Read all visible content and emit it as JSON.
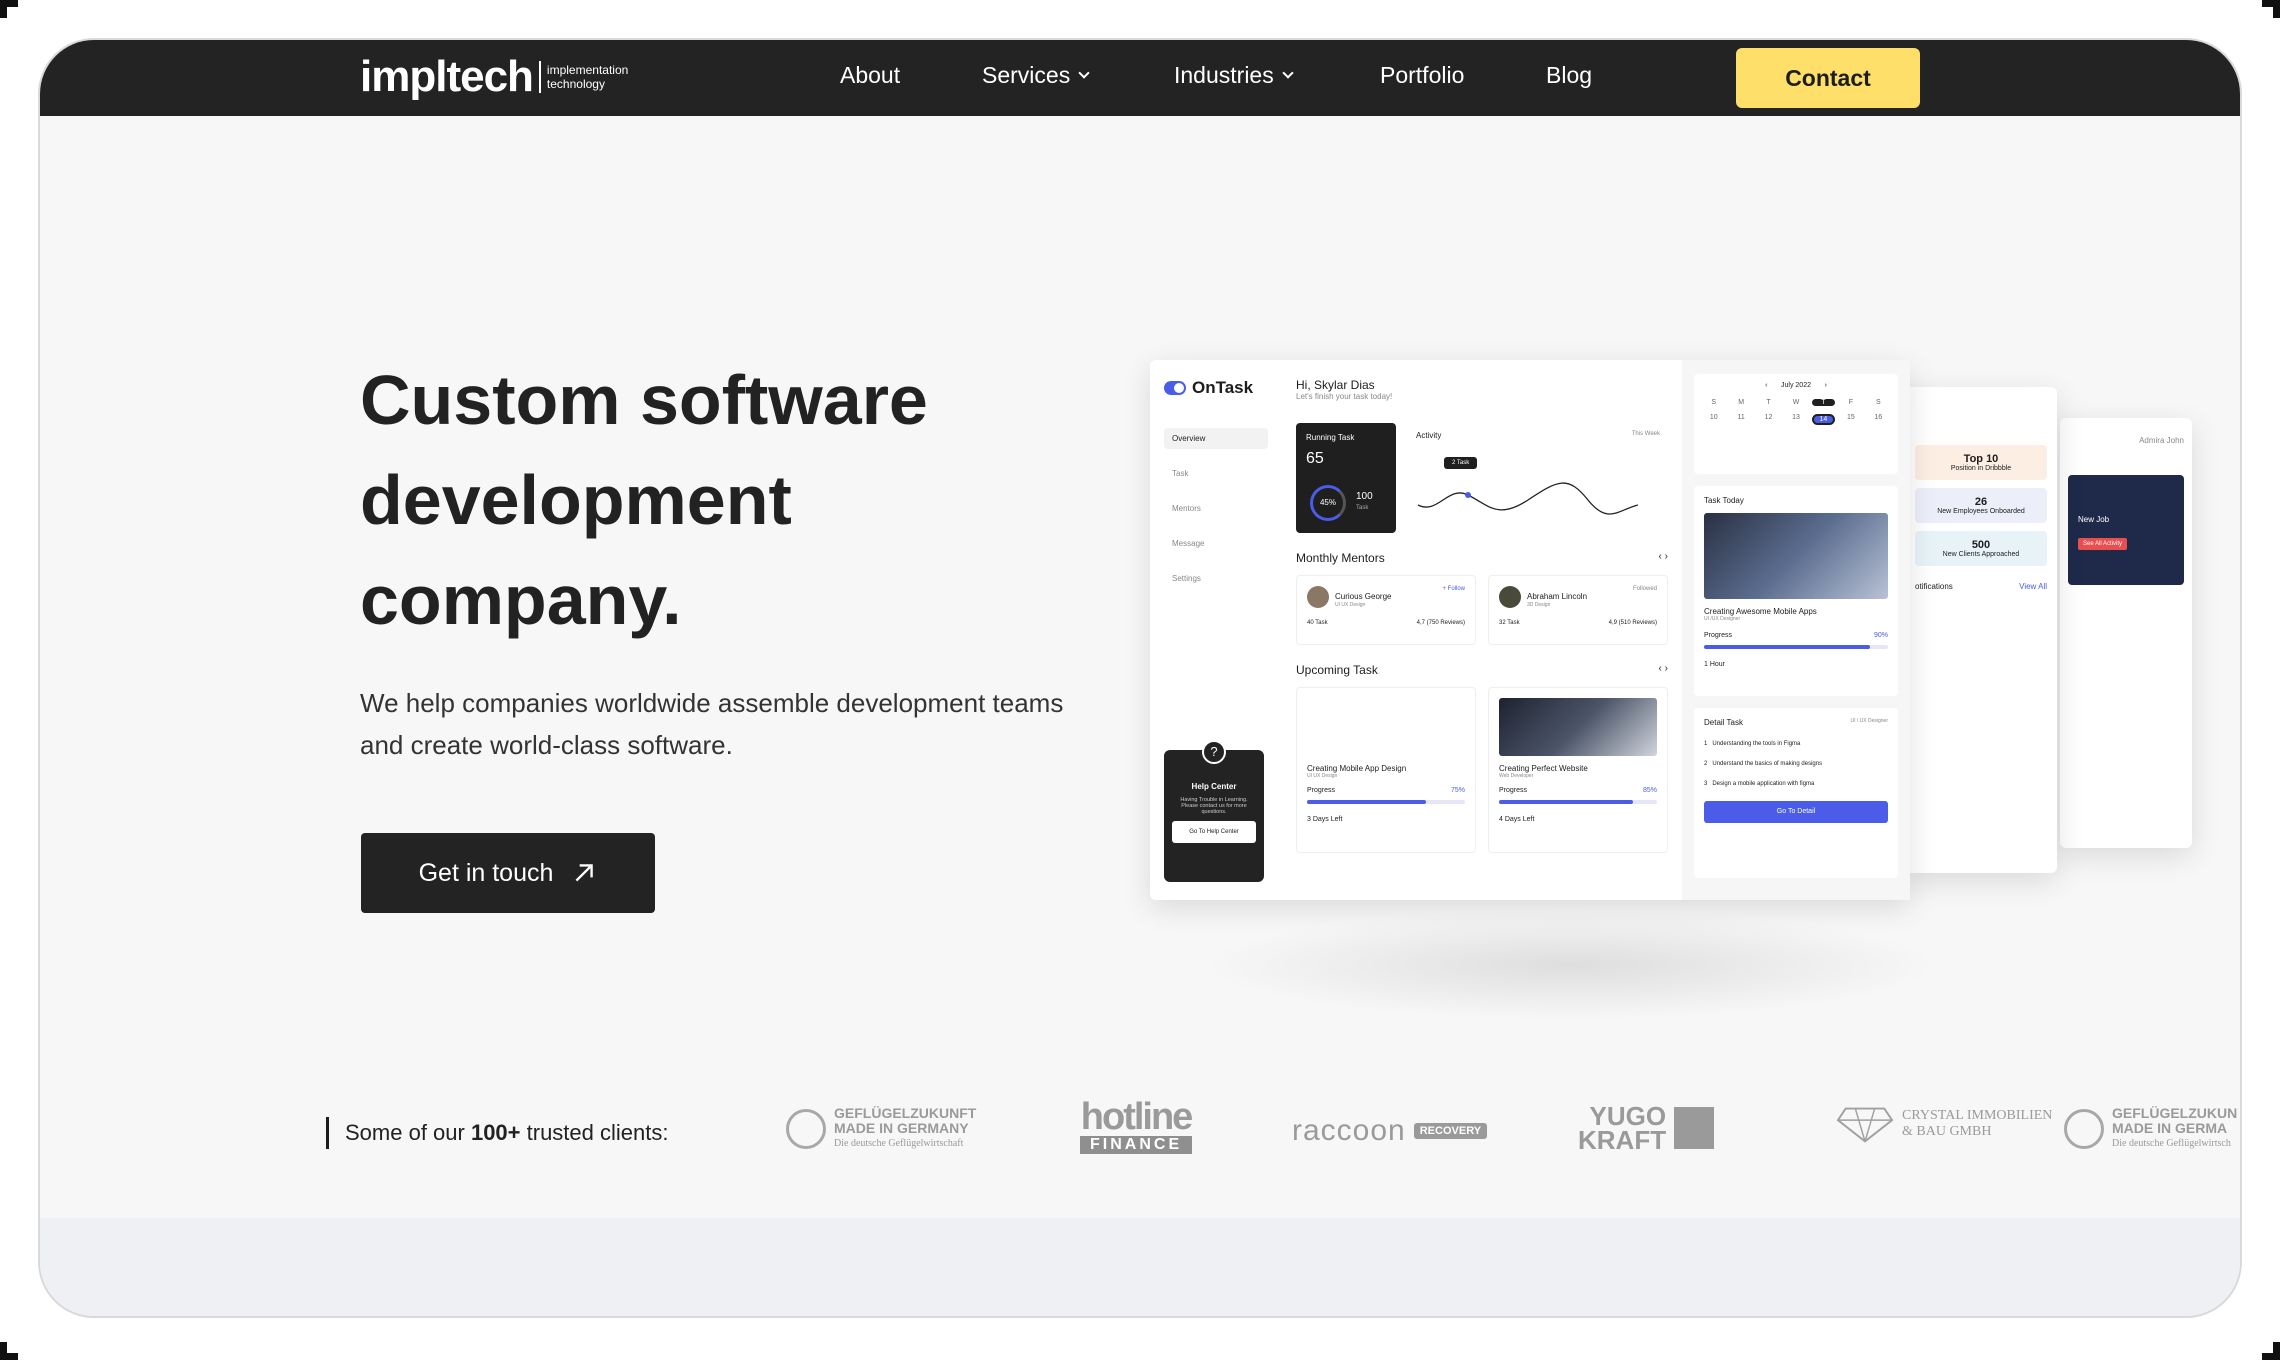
{
  "nav": {
    "logo_word": "impltech",
    "logo_tagline_1": "implementation",
    "logo_tagline_2": "technology",
    "links": [
      "About",
      "Services",
      "Industries",
      "Portfolio",
      "Blog"
    ],
    "contact": "Contact"
  },
  "hero": {
    "title_line1": "Custom software",
    "title_line2": "development",
    "title_line3": "company.",
    "subtitle": "We help companies worldwide assemble development teams and create world-class software.",
    "cta": "Get in touch"
  },
  "mockup": {
    "brand": "OnTask",
    "side_nav": [
      "Overview",
      "Task",
      "Mentors",
      "Message",
      "Settings"
    ],
    "help_title": "Help Center",
    "help_desc": "Having Trouble in Learning. Please contact us for more questions.",
    "help_button": "Go To Help Center",
    "greeting": "Hi, Skylar Dias",
    "greeting_sub": "Let's finish your task today!",
    "running_label": "Running Task",
    "running_value": "65",
    "running_pct": "45%",
    "running_total": "100",
    "running_total_label": "Task",
    "activity_label": "Activity",
    "activity_period": "This Week",
    "activity_badge": "2 Task",
    "monthly_mentors": "Monthly Mentors",
    "mentor1_name": "Curious George",
    "mentor1_role": "UI UX Design",
    "mentor1_action": "+ Follow",
    "mentor1_tasks": "40 Task",
    "mentor1_rating": "4,7 (750 Reviews)",
    "mentor2_name": "Abraham Lincoln",
    "mentor2_role": "3D Design",
    "mentor2_action": "Followed",
    "mentor2_tasks": "32 Task",
    "mentor2_rating": "4,9 (510 Reviews)",
    "upcoming": "Upcoming Task",
    "task1_title": "Creating Mobile App Design",
    "task1_role": "UI UX Design",
    "task1_progress_label": "Progress",
    "task1_progress": "75%",
    "task1_progress_value": 0.75,
    "task1_left": "3 Days Left",
    "task2_title": "Creating Perfect Website",
    "task2_role": "Web Developer",
    "task2_progress_label": "Progress",
    "task2_progress": "85%",
    "task2_progress_value": 0.85,
    "task2_left": "4 Days Left",
    "calendar_month": "July 2022",
    "calendar_days": [
      "S",
      "M",
      "T",
      "W",
      "T",
      "F",
      "S"
    ],
    "calendar_dates": [
      "10",
      "11",
      "12",
      "13",
      "14",
      "15",
      "16"
    ],
    "task_today": "Task Today",
    "today_title": "Creating Awesome Mobile Apps",
    "today_role": "UI /UX Designer",
    "today_progress_label": "Progress",
    "today_progress": "90%",
    "today_progress_value": 0.9,
    "today_time": "1 Hour",
    "detail_label": "Detail Task",
    "detail_role": "UI / UX Designer",
    "detail_items": [
      "Understanding the tools in Figma",
      "Understand the basics of making designs",
      "Design a mobile application with figma"
    ],
    "detail_button": "Go To Detail",
    "stat1_value": "Top 10",
    "stat1_label": "Position in Dribbble",
    "stat2_value": "26",
    "stat2_label": "New Employees Onboarded",
    "stat3_value": "500",
    "stat3_label": "New Clients Approached",
    "notifications": "otifications",
    "view_all": "View All",
    "admin_name": "Admira John",
    "new_job": "New Job",
    "see_activity": "See All Activity"
  },
  "clients": {
    "prefix": "Some of our ",
    "count": "100+",
    "suffix": " trusted clients:",
    "logos": [
      {
        "line1": "GEFLÜGELZUKUNFT",
        "line2": "MADE IN GERMANY",
        "line3": "Die deutsche Geflügelwirtschaft"
      },
      {
        "line1": "hotline",
        "line2": "FINANCE"
      },
      {
        "line1": "raccoon",
        "line2": "RECOVERY"
      },
      {
        "line1": "YUGO",
        "line2": "KRAFT"
      },
      {
        "line1": "CRYSTAL IMMOBILIEN",
        "line2": "& BAU GMBH"
      },
      {
        "line1": "GEFLÜGELZUKUN",
        "line2": "MADE IN GERMA",
        "line3": "Die deutsche Geflügelwirtsch"
      }
    ]
  }
}
